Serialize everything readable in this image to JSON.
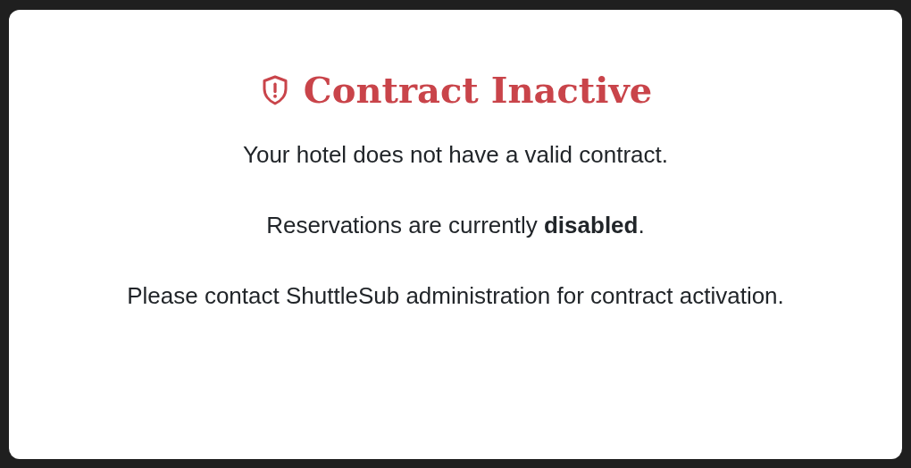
{
  "dialog": {
    "title": "Contract Inactive",
    "paragraphs": [
      "Your hotel does not have a valid contract.",
      "Reservations are currently **disabled**.",
      "Please contact ShuttleSub administration for contract activation."
    ]
  }
}
